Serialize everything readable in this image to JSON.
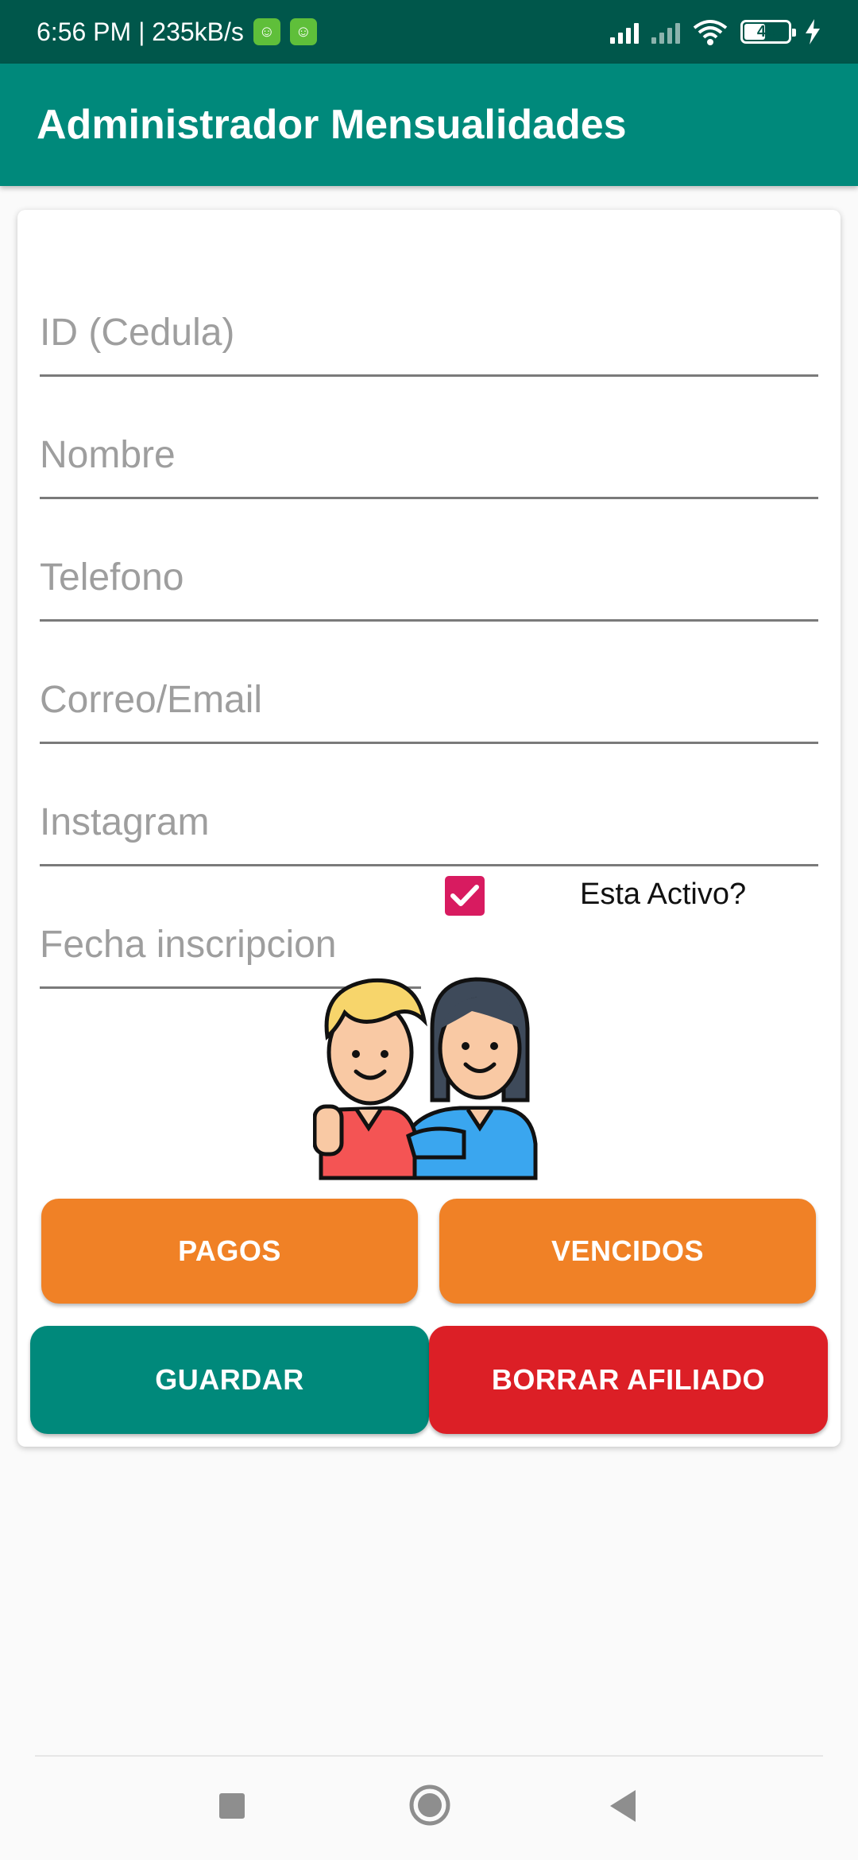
{
  "status_bar": {
    "time_speed": "6:56 PM | 235kB/s",
    "battery_level": "44"
  },
  "app_bar": {
    "title": "Administrador Mensualidades"
  },
  "form": {
    "id_placeholder": "ID (Cedula)",
    "name_placeholder": "Nombre",
    "phone_placeholder": "Telefono",
    "email_placeholder": "Correo/Email",
    "instagram_placeholder": "Instagram",
    "date_placeholder": "Fecha inscripcion",
    "active_label": "Esta Activo?",
    "active_checked": true
  },
  "buttons": {
    "pagos": "PAGOS",
    "vencidos": "VENCIDOS",
    "guardar": "GUARDAR",
    "borrar": "BORRAR AFILIADO"
  },
  "colors": {
    "status_bar": "#00574b",
    "primary": "#00897b",
    "accent": "#d81b60",
    "orange": "#f08126",
    "red": "#dc1f26"
  },
  "icons": {
    "illustration": "two-friends-illustration",
    "nav_recents": "square-icon",
    "nav_home": "circle-icon",
    "nav_back": "triangle-back-icon"
  }
}
